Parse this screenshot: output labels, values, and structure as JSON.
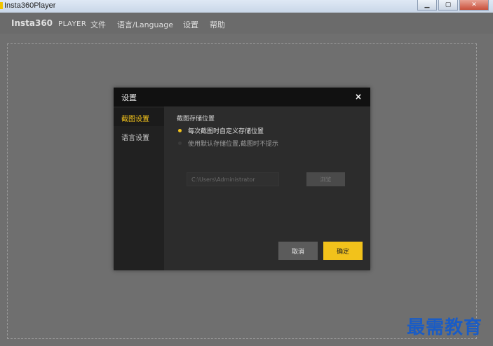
{
  "window": {
    "title": "Insta360Player"
  },
  "menubar": {
    "brand": "Insta360",
    "brand_sub": "PLAYER",
    "items": [
      "文件",
      "语言/Language",
      "设置",
      "帮助"
    ]
  },
  "dialog": {
    "title": "设置",
    "close_icon": "×",
    "sidebar": [
      "截图设置",
      "语言设置"
    ],
    "section_title": "截图存储位置",
    "options": [
      {
        "label": "每次截图时自定义存储位置",
        "selected": true
      },
      {
        "label": "使用默认存储位置,截图时不提示",
        "selected": false
      }
    ],
    "path_value": "C:\\Users\\Administrator",
    "browse_label": "浏览",
    "cancel_label": "取消",
    "ok_label": "确定"
  },
  "colors": {
    "accent": "#f2c21b",
    "background": "#6f6f6f",
    "dialog_bg": "#2c2c2c",
    "watermark": "#1a5cc5"
  },
  "watermark": "最需教育"
}
